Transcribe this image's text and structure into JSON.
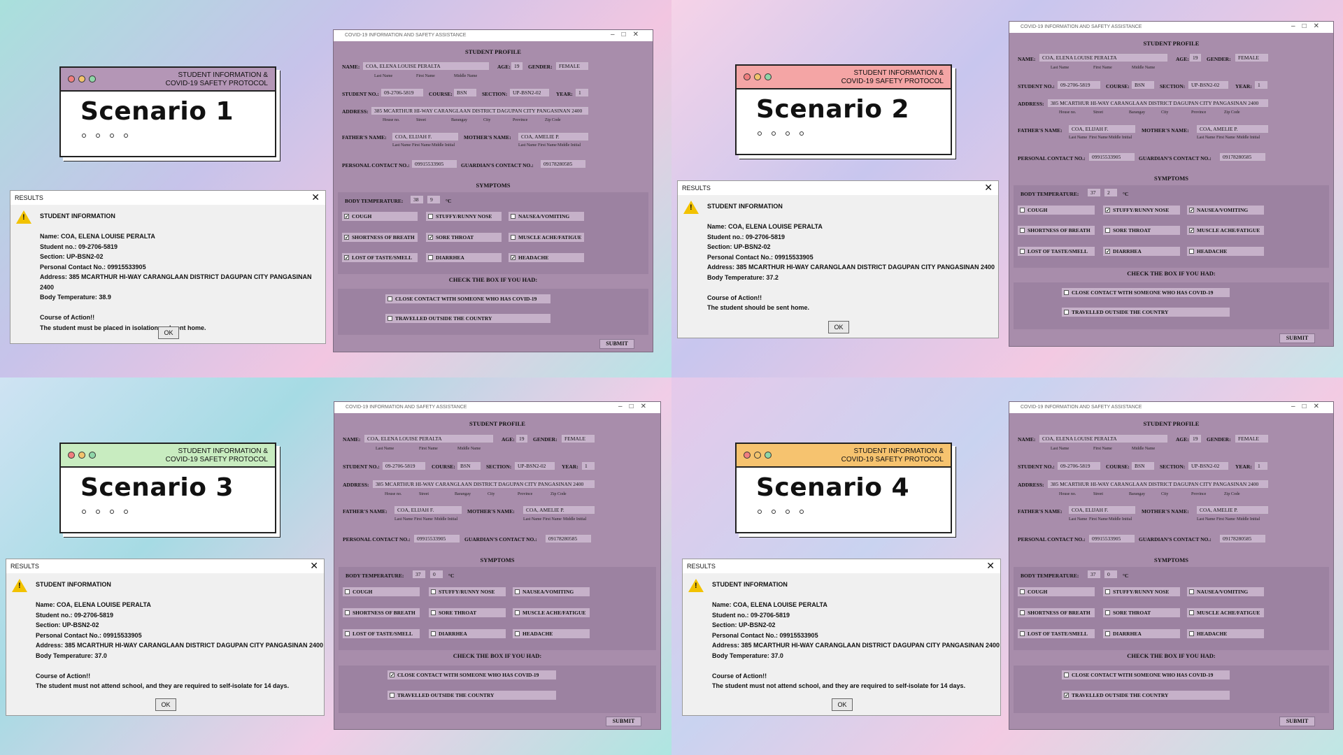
{
  "card_subtitle_line1": "STUDENT INFORMATION &",
  "card_subtitle_line2": "COVID-19 SAFETY PROTOCOL",
  "app_title": "COVID-19 INFORMATION AND SAFETY ASSISTANCE",
  "results_title": "RESULTS",
  "ok_label": "OK",
  "profile": {
    "section_title": "STUDENT PROFILE",
    "name_label": "NAME:",
    "name": "COA, ELENA LOUISE PERALTA",
    "age_label": "AGE:",
    "age": "19",
    "gender_label": "GENDER:",
    "gender": "FEMALE",
    "cap_last": "Last Name",
    "cap_first": "First Name",
    "cap_middle": "Middle Name",
    "student_no_label": "STUDENT NO.:",
    "student_no": "09-2706-5819",
    "course_label": "COURSE:",
    "course": "BSN",
    "section_label": "SECTION:",
    "section": "UP-BSN2-02",
    "year_label": "YEAR:",
    "year": "1",
    "address_label": "ADDRESS:",
    "address": "385 MCARTHUR HI-WAY CARANGLAAN DISTRICT DAGUPAN CITY PANGASINAN 2400",
    "addr_caps": [
      "House no.",
      "Street",
      "Barangay",
      "City",
      "Province",
      "Zip Code"
    ],
    "father_label": "FATHER'S NAME:",
    "father": "COA, ELIJAH F.",
    "mother_label": "MOTHER'S NAME:",
    "mother": "COA, AMELIE P.",
    "cap_mi": "Middle Initial",
    "contact_label": "PERSONAL CONTACT NO.:",
    "contact": "09915533905",
    "guardian_label": "GUARDIAN'S CONTACT NO.:",
    "guardian": "09178280585",
    "symptoms_title": "SYMPTOMS",
    "temp_label": "BODY TEMPERATURE:",
    "celsius": "°C",
    "symptoms": [
      "COUGH",
      "STUFFY/RUNNY NOSE",
      "NAUSEA/VOMITING",
      "SHORTNESS OF BREATH",
      "SORE THROAT",
      "MUSCLE ACHE/FATIGUE",
      "LOST OF TASTE/SMELL",
      "DIARRHEA",
      "HEADACHE"
    ],
    "check_title": "CHECK THE BOX IF YOU HAD:",
    "contact_covid": "CLOSE CONTACT WITH SOMEONE WHO HAS COVID-19",
    "travel": "TRAVELLED OUTSIDE THE COUNTRY",
    "submit": "SUBMIT"
  },
  "scenarios": [
    {
      "title": "Scenario 1",
      "bar_color": "#b496b6",
      "temp_int": "38",
      "temp_dec": "9",
      "checked": [
        true,
        false,
        false,
        true,
        true,
        false,
        true,
        false,
        true
      ],
      "contact_checked": false,
      "travel_checked": false,
      "result": [
        "STUDENT INFORMATION",
        "",
        "Name: COA, ELENA LOUISE PERALTA",
        "Student no.: 09-2706-5819",
        "Section: UP-BSN2-02",
        "Personal Contact No.: 09915533905",
        "Address: 385 MCARTHUR HI-WAY CARANGLAAN DISTRICT DAGUPAN CITY PANGASINAN 2400",
        "Body Temperature: 38.9",
        "",
        "Course of Action!!",
        "The student must be placed in isolation and sent home."
      ]
    },
    {
      "title": "Scenario 2",
      "bar_color": "#f4a5a5",
      "temp_int": "37",
      "temp_dec": "2",
      "checked": [
        false,
        true,
        true,
        false,
        false,
        true,
        false,
        true,
        false
      ],
      "contact_checked": false,
      "travel_checked": false,
      "result": [
        "STUDENT INFORMATION",
        "",
        "Name: COA, ELENA LOUISE PERALTA",
        "Student no.: 09-2706-5819",
        "Section: UP-BSN2-02",
        "Personal Contact No.: 09915533905",
        "Address: 385 MCARTHUR HI-WAY CARANGLAAN DISTRICT DAGUPAN CITY PANGASINAN 2400",
        "Body Temperature: 37.2",
        "",
        "Course of Action!!",
        "The student should be sent home."
      ]
    },
    {
      "title": "Scenario 3",
      "bar_color": "#c8ecc0",
      "temp_int": "37",
      "temp_dec": "0",
      "checked": [
        false,
        false,
        false,
        false,
        false,
        false,
        false,
        false,
        false
      ],
      "contact_checked": true,
      "travel_checked": false,
      "result": [
        "STUDENT INFORMATION",
        "",
        "Name: COA, ELENA LOUISE PERALTA",
        "Student no.: 09-2706-5819",
        "Section: UP-BSN2-02",
        "Personal Contact No.: 09915533905",
        "Address: 385 MCARTHUR HI-WAY CARANGLAAN DISTRICT DAGUPAN CITY PANGASINAN 2400",
        "Body Temperature: 37.0",
        "",
        "Course of Action!!",
        "The student must not attend school, and they are required to self-isolate for 14 days."
      ]
    },
    {
      "title": "Scenario 4",
      "bar_color": "#f6c36f",
      "temp_int": "37",
      "temp_dec": "0",
      "checked": [
        false,
        false,
        false,
        false,
        false,
        false,
        false,
        false,
        false
      ],
      "contact_checked": false,
      "travel_checked": true,
      "result": [
        "STUDENT INFORMATION",
        "",
        "Name: COA, ELENA LOUISE PERALTA",
        "Student no.: 09-2706-5819",
        "Section: UP-BSN2-02",
        "Personal Contact No.: 09915533905",
        "Address: 385 MCARTHUR HI-WAY CARANGLAAN DISTRICT DAGUPAN CITY PANGASINAN 2400",
        "Body Temperature: 37.0",
        "",
        "Course of Action!!",
        "The student must not attend school, and they are required to self-isolate for 14 days."
      ]
    }
  ]
}
